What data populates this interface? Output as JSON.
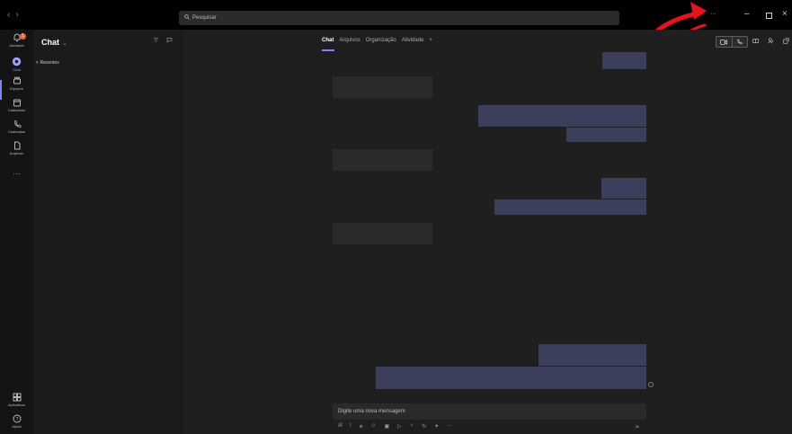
{
  "topbar": {
    "nav_prev": "‹",
    "nav_next": "›",
    "search_placeholder": "Pesquisar",
    "more_label": "···",
    "minimize": "–",
    "close": "×"
  },
  "rail": {
    "items": [
      {
        "label": "Atividade",
        "icon": "bell-icon",
        "badge": "1"
      },
      {
        "label": "Chat",
        "icon": "chat-icon",
        "active": true
      },
      {
        "label": "Equipes",
        "icon": "teams-icon"
      },
      {
        "label": "Calendário",
        "icon": "calendar-icon"
      },
      {
        "label": "Chamadas",
        "icon": "phone-icon"
      },
      {
        "label": "Arquivos",
        "icon": "file-icon"
      }
    ],
    "more": "···",
    "bottom": [
      {
        "label": "Aplicativos",
        "icon": "apps-icon"
      },
      {
        "label": "Ajuda",
        "icon": "help-icon"
      }
    ]
  },
  "list": {
    "title": "Chat",
    "section": "Recentes"
  },
  "main": {
    "tabs": [
      "Chat",
      "Arquivos",
      "Organização",
      "Atividade"
    ],
    "add_tab": "+",
    "composer_placeholder": "Digite uma nova mensagem"
  },
  "colors": {
    "accent": "#7f85f5",
    "outgoing_bubble": "#3d3d5c",
    "incoming_bubble": "#2a2a2a",
    "annotation_arrow": "#e3141b"
  }
}
